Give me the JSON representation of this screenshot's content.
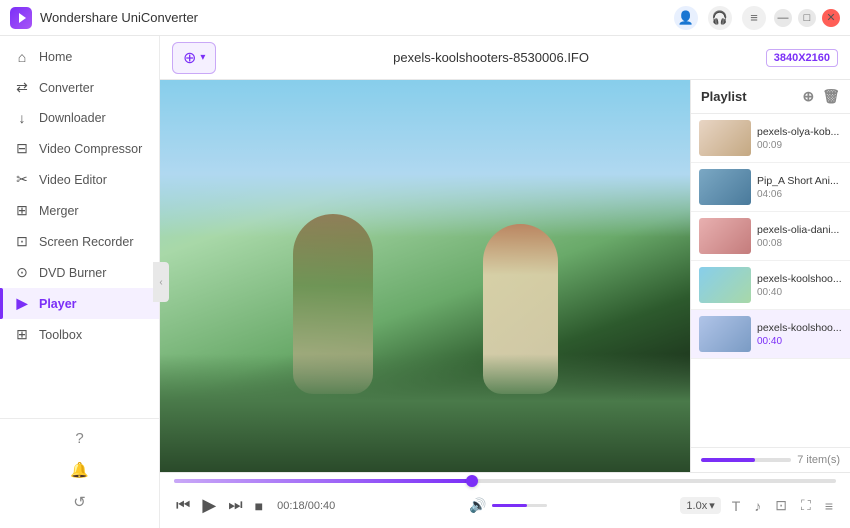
{
  "app": {
    "title": "Wondershare UniConverter",
    "logo_alt": "UniConverter Logo"
  },
  "titlebar": {
    "icons": {
      "user": "👤",
      "headphone": "🎧",
      "menu": "≡"
    },
    "controls": {
      "minimize": "—",
      "maximize": "□",
      "close": "✕"
    }
  },
  "sidebar": {
    "items": [
      {
        "id": "home",
        "label": "Home",
        "icon": "⌂"
      },
      {
        "id": "converter",
        "label": "Converter",
        "icon": "⇄"
      },
      {
        "id": "downloader",
        "label": "Downloader",
        "icon": "↓"
      },
      {
        "id": "video-compressor",
        "label": "Video Compressor",
        "icon": "⊟"
      },
      {
        "id": "video-editor",
        "label": "Video Editor",
        "icon": "✂"
      },
      {
        "id": "merger",
        "label": "Merger",
        "icon": "⊞"
      },
      {
        "id": "screen-recorder",
        "label": "Screen Recorder",
        "icon": "⊡"
      },
      {
        "id": "dvd-burner",
        "label": "DVD Burner",
        "icon": "⊙"
      },
      {
        "id": "player",
        "label": "Player",
        "icon": "▶",
        "active": true
      },
      {
        "id": "toolbox",
        "label": "Toolbox",
        "icon": "⊞"
      }
    ],
    "bottom_icons": [
      "?",
      "🔔",
      "↺"
    ]
  },
  "topbar": {
    "add_button": "+",
    "add_button_label": "Add",
    "filename": "pexels-koolshooters-8530006.IFO",
    "resolution": "3840X2160"
  },
  "playlist": {
    "title": "Playlist",
    "add_icon": "⊕",
    "delete_icon": "🗑",
    "items": [
      {
        "id": 1,
        "name": "pexels-olya-kob...",
        "duration": "00:09",
        "thumb_class": "playlist-thumb-1",
        "active": false
      },
      {
        "id": 2,
        "name": "Pip_A Short Ani...",
        "duration": "04:06",
        "thumb_class": "playlist-thumb-2",
        "active": false
      },
      {
        "id": 3,
        "name": "pexels-olia-dani...",
        "duration": "00:08",
        "thumb_class": "playlist-thumb-3",
        "active": false
      },
      {
        "id": 4,
        "name": "pexels-koolshoo...",
        "duration": "00:40",
        "thumb_class": "playlist-thumb-4",
        "active": false
      },
      {
        "id": 5,
        "name": "pexels-koolshoo...",
        "duration": "00:40",
        "thumb_class": "playlist-thumb-5",
        "active": true
      }
    ],
    "footer": "7 item(s)",
    "progress_pct": 60
  },
  "controls": {
    "time_current": "00:18",
    "time_total": "00:40",
    "progress_pct": 45,
    "volume_pct": 65,
    "speed": "1.0x",
    "buttons": {
      "prev": "⏮",
      "play": "▶",
      "next_frame": "⏭",
      "stop": "■",
      "volume": "🔊",
      "speed_chevron": "▾",
      "caption": "T",
      "audio": "♪",
      "screenshot": "⊡",
      "fullscreen": "⛶",
      "more": "≡"
    }
  }
}
